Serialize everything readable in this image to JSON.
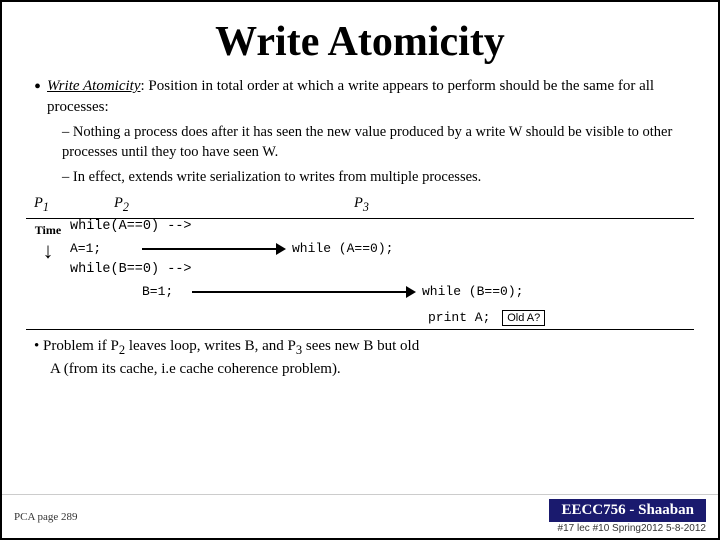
{
  "slide": {
    "title": "Write Atomicity",
    "bullet": {
      "term": "Write Atomicity",
      "definition_start": ":  Position in total order at which a write appears to perform should be the same for all processes:",
      "sub1": "Nothing a process does after it has seen the new value produced by a write W should be visible to other processes until they too have seen W.",
      "sub2": "In effect, extends write serialization to writes from multiple processes.",
      "p1_label": "P",
      "p1_sub": "1",
      "p2_label": "P",
      "p2_sub": "2",
      "p3_label": "P",
      "p3_sub": "3"
    },
    "time_label": "Time",
    "diagram": {
      "row1_code1": "A=1;",
      "row1_code2": "while (A==0);",
      "row2_code1": "B=1;",
      "row2_code2": "while (B==0);",
      "row3_code": "print A;",
      "old_a_badge": "Old A?"
    },
    "problem": {
      "text_start": "• Problem if P",
      "p2_sub": "2",
      "text_mid": " leaves loop, writes B, and P",
      "p3_sub": "3",
      "text_end": " sees new B but old",
      "line2": "A  (from its cache, i.e cache coherence problem)."
    },
    "footer": {
      "left": "PCA page 289",
      "right_box": "EECC756 - Shaaban",
      "slide_info": "#17  lec #10  Spring2012  5-8-2012"
    }
  }
}
